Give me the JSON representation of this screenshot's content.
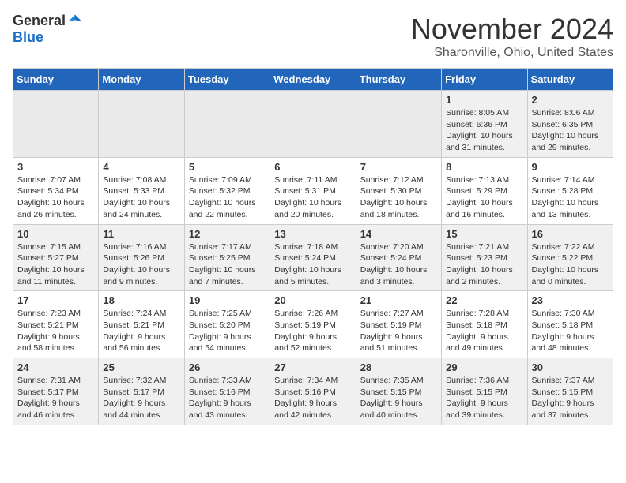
{
  "header": {
    "logo_general": "General",
    "logo_blue": "Blue",
    "month_title": "November 2024",
    "location": "Sharonville, Ohio, United States"
  },
  "weekdays": [
    "Sunday",
    "Monday",
    "Tuesday",
    "Wednesday",
    "Thursday",
    "Friday",
    "Saturday"
  ],
  "weeks": [
    [
      {
        "day": "",
        "info": ""
      },
      {
        "day": "",
        "info": ""
      },
      {
        "day": "",
        "info": ""
      },
      {
        "day": "",
        "info": ""
      },
      {
        "day": "",
        "info": ""
      },
      {
        "day": "1",
        "info": "Sunrise: 8:05 AM\nSunset: 6:36 PM\nDaylight: 10 hours\nand 31 minutes."
      },
      {
        "day": "2",
        "info": "Sunrise: 8:06 AM\nSunset: 6:35 PM\nDaylight: 10 hours\nand 29 minutes."
      }
    ],
    [
      {
        "day": "3",
        "info": "Sunrise: 7:07 AM\nSunset: 5:34 PM\nDaylight: 10 hours\nand 26 minutes."
      },
      {
        "day": "4",
        "info": "Sunrise: 7:08 AM\nSunset: 5:33 PM\nDaylight: 10 hours\nand 24 minutes."
      },
      {
        "day": "5",
        "info": "Sunrise: 7:09 AM\nSunset: 5:32 PM\nDaylight: 10 hours\nand 22 minutes."
      },
      {
        "day": "6",
        "info": "Sunrise: 7:11 AM\nSunset: 5:31 PM\nDaylight: 10 hours\nand 20 minutes."
      },
      {
        "day": "7",
        "info": "Sunrise: 7:12 AM\nSunset: 5:30 PM\nDaylight: 10 hours\nand 18 minutes."
      },
      {
        "day": "8",
        "info": "Sunrise: 7:13 AM\nSunset: 5:29 PM\nDaylight: 10 hours\nand 16 minutes."
      },
      {
        "day": "9",
        "info": "Sunrise: 7:14 AM\nSunset: 5:28 PM\nDaylight: 10 hours\nand 13 minutes."
      }
    ],
    [
      {
        "day": "10",
        "info": "Sunrise: 7:15 AM\nSunset: 5:27 PM\nDaylight: 10 hours\nand 11 minutes."
      },
      {
        "day": "11",
        "info": "Sunrise: 7:16 AM\nSunset: 5:26 PM\nDaylight: 10 hours\nand 9 minutes."
      },
      {
        "day": "12",
        "info": "Sunrise: 7:17 AM\nSunset: 5:25 PM\nDaylight: 10 hours\nand 7 minutes."
      },
      {
        "day": "13",
        "info": "Sunrise: 7:18 AM\nSunset: 5:24 PM\nDaylight: 10 hours\nand 5 minutes."
      },
      {
        "day": "14",
        "info": "Sunrise: 7:20 AM\nSunset: 5:24 PM\nDaylight: 10 hours\nand 3 minutes."
      },
      {
        "day": "15",
        "info": "Sunrise: 7:21 AM\nSunset: 5:23 PM\nDaylight: 10 hours\nand 2 minutes."
      },
      {
        "day": "16",
        "info": "Sunrise: 7:22 AM\nSunset: 5:22 PM\nDaylight: 10 hours\nand 0 minutes."
      }
    ],
    [
      {
        "day": "17",
        "info": "Sunrise: 7:23 AM\nSunset: 5:21 PM\nDaylight: 9 hours\nand 58 minutes."
      },
      {
        "day": "18",
        "info": "Sunrise: 7:24 AM\nSunset: 5:21 PM\nDaylight: 9 hours\nand 56 minutes."
      },
      {
        "day": "19",
        "info": "Sunrise: 7:25 AM\nSunset: 5:20 PM\nDaylight: 9 hours\nand 54 minutes."
      },
      {
        "day": "20",
        "info": "Sunrise: 7:26 AM\nSunset: 5:19 PM\nDaylight: 9 hours\nand 52 minutes."
      },
      {
        "day": "21",
        "info": "Sunrise: 7:27 AM\nSunset: 5:19 PM\nDaylight: 9 hours\nand 51 minutes."
      },
      {
        "day": "22",
        "info": "Sunrise: 7:28 AM\nSunset: 5:18 PM\nDaylight: 9 hours\nand 49 minutes."
      },
      {
        "day": "23",
        "info": "Sunrise: 7:30 AM\nSunset: 5:18 PM\nDaylight: 9 hours\nand 48 minutes."
      }
    ],
    [
      {
        "day": "24",
        "info": "Sunrise: 7:31 AM\nSunset: 5:17 PM\nDaylight: 9 hours\nand 46 minutes."
      },
      {
        "day": "25",
        "info": "Sunrise: 7:32 AM\nSunset: 5:17 PM\nDaylight: 9 hours\nand 44 minutes."
      },
      {
        "day": "26",
        "info": "Sunrise: 7:33 AM\nSunset: 5:16 PM\nDaylight: 9 hours\nand 43 minutes."
      },
      {
        "day": "27",
        "info": "Sunrise: 7:34 AM\nSunset: 5:16 PM\nDaylight: 9 hours\nand 42 minutes."
      },
      {
        "day": "28",
        "info": "Sunrise: 7:35 AM\nSunset: 5:15 PM\nDaylight: 9 hours\nand 40 minutes."
      },
      {
        "day": "29",
        "info": "Sunrise: 7:36 AM\nSunset: 5:15 PM\nDaylight: 9 hours\nand 39 minutes."
      },
      {
        "day": "30",
        "info": "Sunrise: 7:37 AM\nSunset: 5:15 PM\nDaylight: 9 hours\nand 37 minutes."
      }
    ]
  ]
}
